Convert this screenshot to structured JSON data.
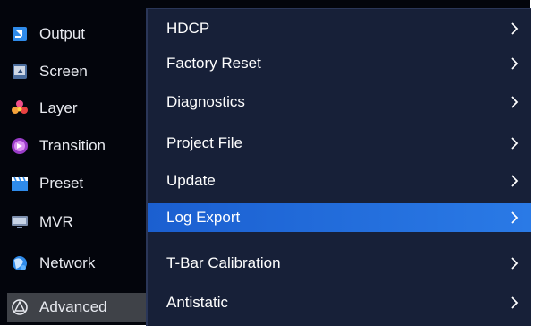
{
  "sidebar": {
    "items": [
      {
        "label": "Output",
        "icon": "output-icon"
      },
      {
        "label": "Screen",
        "icon": "screen-icon"
      },
      {
        "label": "Layer",
        "icon": "layer-icon"
      },
      {
        "label": "Transition",
        "icon": "transition-icon"
      },
      {
        "label": "Preset",
        "icon": "preset-icon"
      },
      {
        "label": "MVR",
        "icon": "mvr-icon"
      },
      {
        "label": "Network",
        "icon": "network-icon"
      },
      {
        "label": "Advanced",
        "icon": "advanced-icon"
      }
    ],
    "active": "Advanced"
  },
  "submenu": {
    "items": [
      {
        "label": "HDCP"
      },
      {
        "label": "Factory Reset"
      },
      {
        "label": "Diagnostics"
      },
      {
        "label": "Project File"
      },
      {
        "label": "Update"
      },
      {
        "label": "Log Export"
      },
      {
        "label": "T-Bar Calibration"
      },
      {
        "label": "Antistatic"
      }
    ],
    "selected": "Log Export"
  },
  "colors": {
    "background": "#03050c",
    "panel": "#172038",
    "highlight": "#1f66d8",
    "active_sidebar": "#3f4248",
    "text": "#ffffff"
  }
}
